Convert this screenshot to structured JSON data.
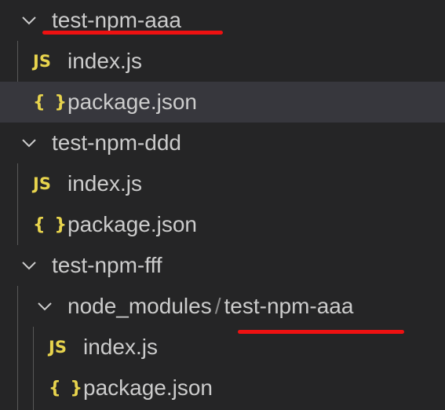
{
  "tree": {
    "folder_aaa": {
      "label": "test-npm-aaa"
    },
    "aaa_index": {
      "icon": "JS",
      "label": "index.js"
    },
    "aaa_package": {
      "icon": "{ }",
      "label": "package.json"
    },
    "folder_ddd": {
      "label": "test-npm-ddd"
    },
    "ddd_index": {
      "icon": "JS",
      "label": "index.js"
    },
    "ddd_package": {
      "icon": "{ }",
      "label": "package.json"
    },
    "folder_fff": {
      "label": "test-npm-fff"
    },
    "node_modules": {
      "label": "node_modules",
      "separator": "/",
      "child_label": "test-npm-aaa"
    },
    "nm_index": {
      "icon": "JS",
      "label": "index.js"
    },
    "nm_package": {
      "icon": "{ }",
      "label": "package.json"
    }
  },
  "colors": {
    "background": "#252526",
    "selected_row": "#37373d",
    "text": "#cccccc",
    "file_icon": "#e8d44d",
    "annotation": "#ee1111"
  }
}
